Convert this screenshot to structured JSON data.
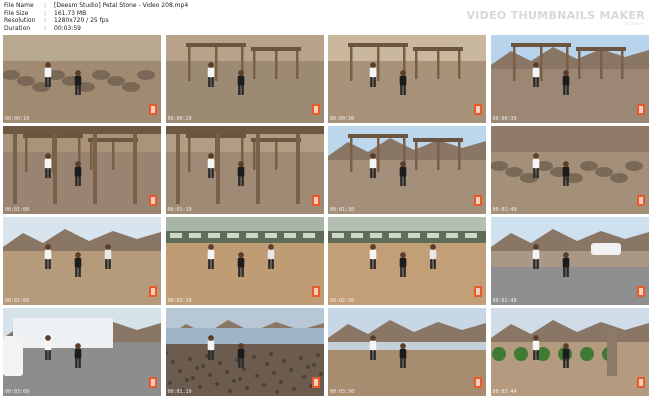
{
  "meta": {
    "file_name_key": "File Name",
    "file_name": "[Deesm Studio] Petal Stone - Video 208.mp4",
    "file_size_key": "File Size",
    "file_size": "161.73 MB",
    "resolution_key": "Resolution",
    "resolution": "1280x720 / 25 fps",
    "duration_key": "Duration",
    "duration": "00:03:59",
    "separator": ":"
  },
  "watermark": {
    "title": "VIDEO THUMBNAILS MAKER",
    "subtitle": "by Sauce"
  },
  "thumbnails": [
    {
      "time": "00:00:10",
      "scene": "desert-rocks-kneeling",
      "colors": {
        "sky": "#b9a890",
        "ground": "#a08a72"
      }
    },
    {
      "time": "00:00:20",
      "scene": "desert-wood-posts",
      "colors": {
        "sky": "#b8a38a",
        "ground": "#9d8a74"
      }
    },
    {
      "time": "00:00:30",
      "scene": "desert-shelters",
      "colors": {
        "sky": "#c9b79e",
        "ground": "#a89279"
      }
    },
    {
      "time": "00:00:39",
      "scene": "mountain-sky-shelter",
      "colors": {
        "sky": "#b8d4ec",
        "ground": "#9b8774"
      }
    },
    {
      "time": "00:01:00",
      "scene": "shelter-under-roof",
      "colors": {
        "sky": "#a99379",
        "ground": "#988470"
      }
    },
    {
      "time": "00:01:10",
      "scene": "shelter-under-roof",
      "colors": {
        "sky": "#b19d84",
        "ground": "#9f8b75"
      }
    },
    {
      "time": "00:01:30",
      "scene": "mountain-sky-shelter",
      "colors": {
        "sky": "#bcd6ec",
        "ground": "#a38f7a"
      }
    },
    {
      "time": "00:01:40",
      "scene": "desert-rock-figure",
      "colors": {
        "sky": "#8e7a66",
        "ground": "#a49079"
      }
    },
    {
      "time": "00:02:00",
      "scene": "desert-group",
      "colors": {
        "sky": "#d8e4ee",
        "ground": "#b69a7c"
      }
    },
    {
      "time": "00:02:10",
      "scene": "train-desert",
      "colors": {
        "sky": "#a8b6a8",
        "ground": "#c09c74"
      }
    },
    {
      "time": "00:02:30",
      "scene": "train-desert",
      "colors": {
        "sky": "#b4c0b2",
        "ground": "#c39f77"
      }
    },
    {
      "time": "00:02:48",
      "scene": "road-car",
      "colors": {
        "sky": "#cfe0ee",
        "ground": "#a99886"
      }
    },
    {
      "time": "00:03:00",
      "scene": "town-street",
      "colors": {
        "sky": "#d6e2ea",
        "ground": "#8d8d8d"
      }
    },
    {
      "time": "00:03:10",
      "scene": "beach-stones",
      "colors": {
        "sky": "#b8c7d6",
        "ground": "#6b5c4f"
      }
    },
    {
      "time": "00:03:30",
      "scene": "coast-mountains",
      "colors": {
        "sky": "#c8d7e6",
        "ground": "#a88c70"
      }
    },
    {
      "time": "00:03:44",
      "scene": "garden-path",
      "colors": {
        "sky": "#d0dde8",
        "ground": "#b49a7e"
      }
    }
  ]
}
